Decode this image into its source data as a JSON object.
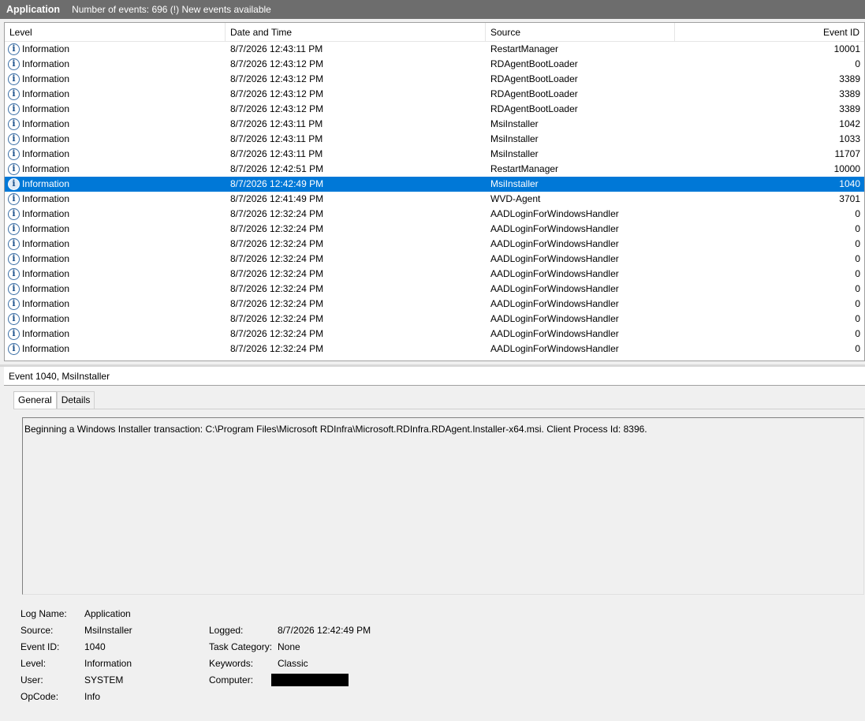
{
  "titlebar": {
    "app": "Application",
    "count": "Number of events: 696 (!) New events available"
  },
  "grid": {
    "columns": [
      "Level",
      "Date and Time",
      "Source",
      "Event ID"
    ],
    "rows": [
      {
        "level": "Information",
        "date": "8/7/2026 12:43:11 PM",
        "source": "RestartManager",
        "eid": "10001"
      },
      {
        "level": "Information",
        "date": "8/7/2026 12:43:12 PM",
        "source": "RDAgentBootLoader",
        "eid": "0"
      },
      {
        "level": "Information",
        "date": "8/7/2026 12:43:12 PM",
        "source": "RDAgentBootLoader",
        "eid": "3389"
      },
      {
        "level": "Information",
        "date": "8/7/2026 12:43:12 PM",
        "source": "RDAgentBootLoader",
        "eid": "3389"
      },
      {
        "level": "Information",
        "date": "8/7/2026 12:43:12 PM",
        "source": "RDAgentBootLoader",
        "eid": "3389"
      },
      {
        "level": "Information",
        "date": "8/7/2026 12:43:11 PM",
        "source": "MsiInstaller",
        "eid": "1042"
      },
      {
        "level": "Information",
        "date": "8/7/2026 12:43:11 PM",
        "source": "MsiInstaller",
        "eid": "1033"
      },
      {
        "level": "Information",
        "date": "8/7/2026 12:43:11 PM",
        "source": "MsiInstaller",
        "eid": "11707"
      },
      {
        "level": "Information",
        "date": "8/7/2026 12:42:51 PM",
        "source": "RestartManager",
        "eid": "10000"
      },
      {
        "level": "Information",
        "date": "8/7/2026 12:42:49 PM",
        "source": "MsiInstaller",
        "eid": "1040",
        "selected": true
      },
      {
        "level": "Information",
        "date": "8/7/2026 12:41:49 PM",
        "source": "WVD-Agent",
        "eid": "3701"
      },
      {
        "level": "Information",
        "date": "8/7/2026 12:32:24 PM",
        "source": "AADLoginForWindowsHandler",
        "eid": "0"
      },
      {
        "level": "Information",
        "date": "8/7/2026 12:32:24 PM",
        "source": "AADLoginForWindowsHandler",
        "eid": "0"
      },
      {
        "level": "Information",
        "date": "8/7/2026 12:32:24 PM",
        "source": "AADLoginForWindowsHandler",
        "eid": "0"
      },
      {
        "level": "Information",
        "date": "8/7/2026 12:32:24 PM",
        "source": "AADLoginForWindowsHandler",
        "eid": "0"
      },
      {
        "level": "Information",
        "date": "8/7/2026 12:32:24 PM",
        "source": "AADLoginForWindowsHandler",
        "eid": "0"
      },
      {
        "level": "Information",
        "date": "8/7/2026 12:32:24 PM",
        "source": "AADLoginForWindowsHandler",
        "eid": "0"
      },
      {
        "level": "Information",
        "date": "8/7/2026 12:32:24 PM",
        "source": "AADLoginForWindowsHandler",
        "eid": "0"
      },
      {
        "level": "Information",
        "date": "8/7/2026 12:32:24 PM",
        "source": "AADLoginForWindowsHandler",
        "eid": "0"
      },
      {
        "level": "Information",
        "date": "8/7/2026 12:32:24 PM",
        "source": "AADLoginForWindowsHandler",
        "eid": "0"
      },
      {
        "level": "Information",
        "date": "8/7/2026 12:32:24 PM",
        "source": "AADLoginForWindowsHandler",
        "eid": "0"
      }
    ]
  },
  "detail": {
    "header": "Event 1040, MsiInstaller",
    "tabs": [
      "General",
      "Details"
    ],
    "description": "Beginning a Windows Installer transaction: C:\\Program Files\\Microsoft RDInfra\\Microsoft.RDInfra.RDAgent.Installer-x64.msi. Client Process Id: 8396.",
    "props": {
      "log_name_label": "Log Name:",
      "log_name": "Application",
      "source_label": "Source:",
      "source": "MsiInstaller",
      "logged_label": "Logged:",
      "logged": "8/7/2026 12:42:49 PM",
      "event_id_label": "Event ID:",
      "event_id": "1040",
      "task_category_label": "Task Category:",
      "task_category": "None",
      "level_label": "Level:",
      "level": "Information",
      "keywords_label": "Keywords:",
      "keywords": "Classic",
      "user_label": "User:",
      "user": "SYSTEM",
      "computer_label": "Computer:",
      "opcode_label": "OpCode:",
      "opcode": "Info"
    }
  },
  "icons": {
    "level_icon": "information-icon"
  },
  "colors": {
    "selection": "#0078d7",
    "titlebar": "#6d6d6d"
  }
}
